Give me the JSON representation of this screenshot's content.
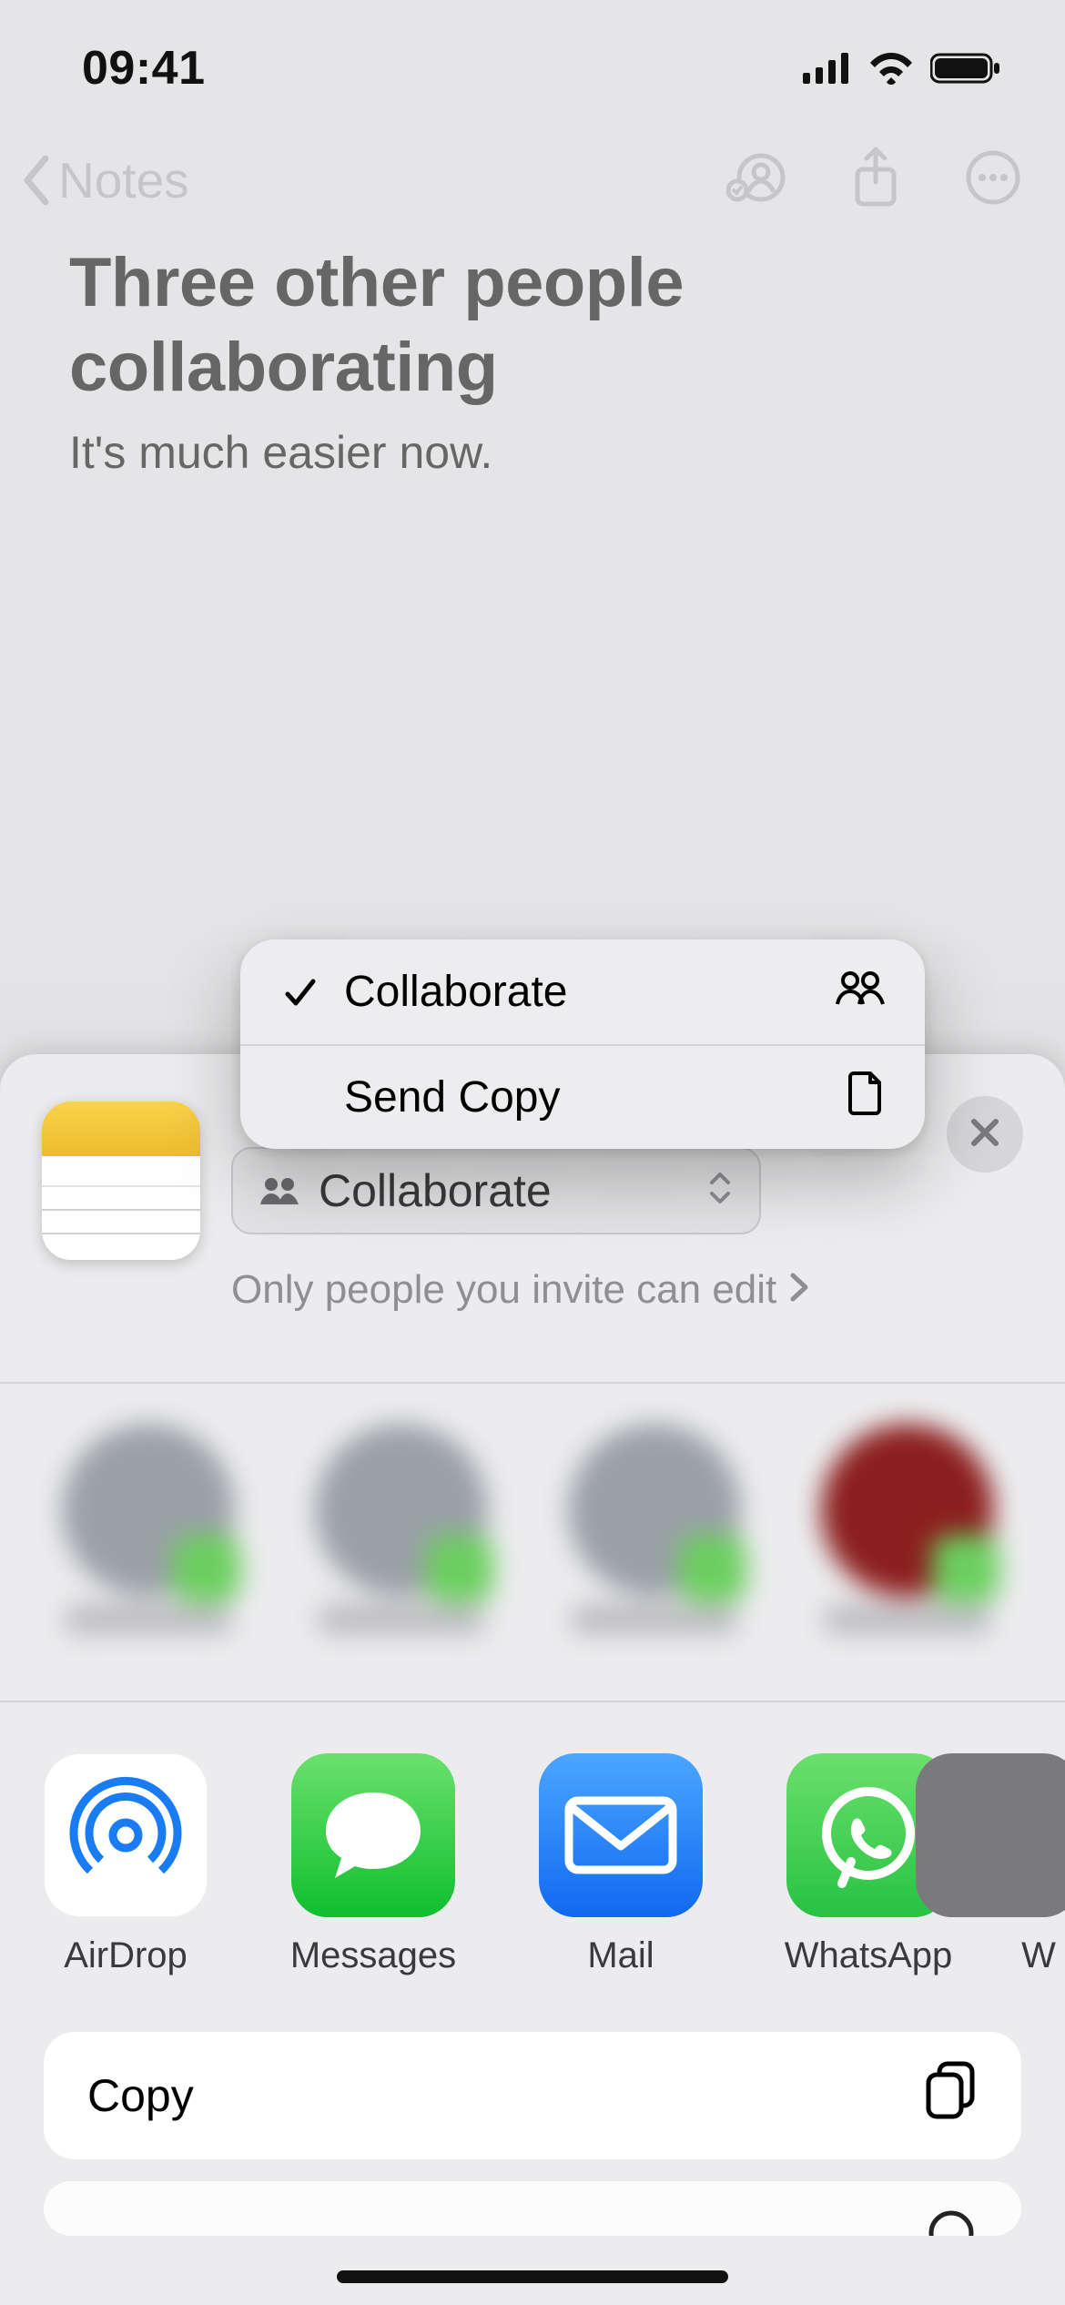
{
  "status": {
    "time": "09:41"
  },
  "nav": {
    "back_label": "Notes"
  },
  "note": {
    "title": "Three other people collaborating",
    "body": "It's much easier now."
  },
  "popover": {
    "items": [
      {
        "label": "Collaborate",
        "checked": true,
        "icon": "people"
      },
      {
        "label": "Send Copy",
        "checked": false,
        "icon": "document"
      }
    ]
  },
  "sheet": {
    "mode_label": "Collaborate",
    "permission_text": "Only people you invite can edit"
  },
  "apps": [
    {
      "label": "AirDrop"
    },
    {
      "label": "Messages"
    },
    {
      "label": "Mail"
    },
    {
      "label": "WhatsApp"
    }
  ],
  "apps_partial_label": "W",
  "actions": [
    {
      "label": "Copy"
    }
  ]
}
